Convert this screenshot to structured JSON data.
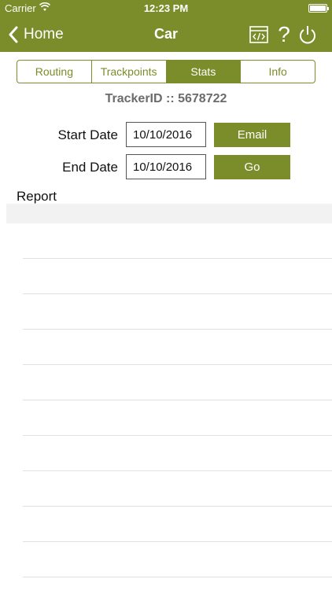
{
  "status": {
    "carrier": "Carrier",
    "time": "12:23 PM"
  },
  "nav": {
    "back_label": "Home",
    "title": "Car",
    "help_glyph": "?"
  },
  "icons": {
    "wifi": "wifi-icon",
    "back": "chevron-left-icon",
    "code": "code-window-icon",
    "help": "question-mark-icon",
    "power": "power-icon",
    "battery": "battery-icon"
  },
  "tabs": [
    {
      "label": "Routing"
    },
    {
      "label": "Trackpoints"
    },
    {
      "label": "Stats"
    },
    {
      "label": "Info"
    }
  ],
  "active_tab": "Stats",
  "tracker": {
    "text": "TrackerID :: 5678722"
  },
  "form": {
    "start_label": "Start Date",
    "start_value": "10/10/2016",
    "end_label": "End Date",
    "end_value": "10/10/2016",
    "email_label": "Email",
    "go_label": "Go"
  },
  "report": {
    "label": "Report"
  },
  "colors": {
    "accent": "#7b8c2a"
  }
}
